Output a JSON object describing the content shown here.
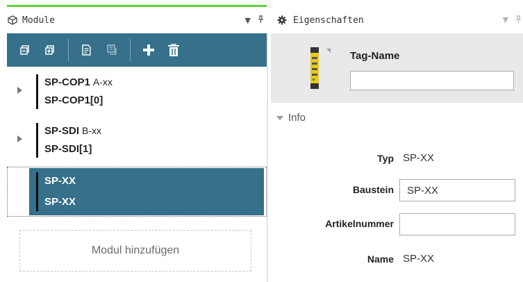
{
  "modules_panel": {
    "title": "Module",
    "icon": "cube-icon",
    "toolbar": [
      {
        "name": "collapse-all-button",
        "icon": "collapse-icon"
      },
      {
        "name": "expand-all-button",
        "icon": "expand-icon"
      },
      {
        "name": "edit-button",
        "icon": "edit-document-icon"
      },
      {
        "name": "copy-button",
        "icon": "copy-document-icon"
      },
      {
        "name": "add-button",
        "icon": "plus-icon"
      },
      {
        "name": "delete-button",
        "icon": "trash-icon"
      }
    ],
    "items": [
      {
        "name": "SP-COP1",
        "variant": "A-xx",
        "label": "SP-COP1[0]",
        "expandable": true,
        "selected": false
      },
      {
        "name": "SP-SDI",
        "variant": "B-xx",
        "label": "SP-SDI[1]",
        "expandable": true,
        "selected": false
      },
      {
        "name": "SP-XX",
        "variant": "",
        "label": "SP-XX",
        "expandable": false,
        "selected": true
      }
    ],
    "add_module_label": "Modul hinzufügen"
  },
  "properties_panel": {
    "title": "Eigenschaften",
    "icon": "gear-icon",
    "tag_name_label": "Tag-Name",
    "tag_name_value": "",
    "info_label": "Info",
    "rows": {
      "typ": {
        "label": "Typ",
        "value": "SP-XX"
      },
      "baustein": {
        "label": "Baustein",
        "value": "SP-XX"
      },
      "artikelnummer": {
        "label": "Artikelnummer",
        "value": ""
      },
      "name": {
        "label": "Name",
        "value": "SP-XX"
      }
    }
  },
  "colors": {
    "toolbar": "#36708a",
    "selection": "#36708a",
    "accent_green": "#5fd13a",
    "tag_section_bg": "#e9e9e9"
  }
}
